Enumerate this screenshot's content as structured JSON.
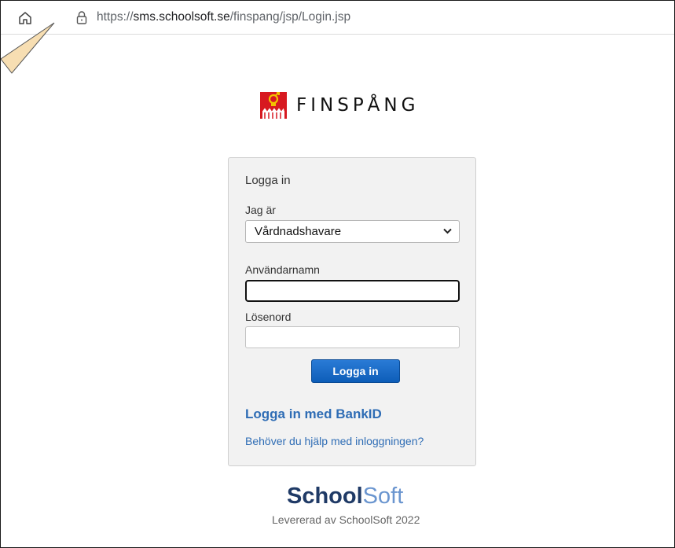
{
  "browser": {
    "url_prefix": "https://",
    "url_host": "sms.schoolsoft.se",
    "url_path": "/finspang/jsp/Login.jsp",
    "icons": {
      "home": "home-icon",
      "lock": "lock-icon"
    }
  },
  "logo": {
    "text": "FINSPÅNG",
    "crest": "municipal-crest-icon"
  },
  "login": {
    "title": "Logga in",
    "role_label": "Jag är",
    "role_value": "Vårdnadshavare",
    "username_label": "Användarnamn",
    "username_value": "",
    "password_label": "Lösenord",
    "password_value": "",
    "submit_label": "Logga in",
    "bankid_link": "Logga in med BankID",
    "help_link": "Behöver du hjälp med inloggningen?"
  },
  "brand": {
    "part1": "School",
    "part2": "Soft",
    "footer": "Levererad av SchoolSoft 2022"
  },
  "colors": {
    "link": "#2f6db5",
    "button": "#0d5db8",
    "brand_dark": "#1f3a66",
    "brand_light": "#6a95cf",
    "crest_red": "#d71920"
  }
}
